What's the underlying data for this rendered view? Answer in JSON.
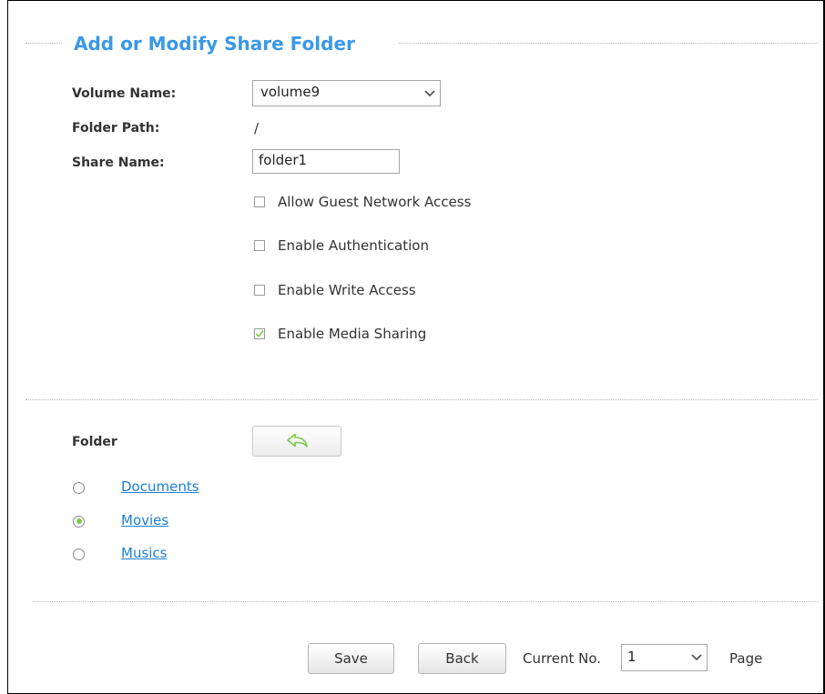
{
  "section_title": "Add or Modify Share Folder",
  "form": {
    "volume_label": "Volume Name:",
    "volume_value": "volume9",
    "path_label": "Folder Path:",
    "path_value": "/",
    "share_label": "Share Name:",
    "share_value": "folder1"
  },
  "options": [
    {
      "label": "Allow Guest Network Access",
      "checked": false
    },
    {
      "label": "Enable Authentication",
      "checked": false
    },
    {
      "label": "Enable Write Access",
      "checked": false
    },
    {
      "label": "Enable Media Sharing",
      "checked": true
    }
  ],
  "folder": {
    "label": "Folder",
    "back_icon": "reply-arrow-icon",
    "items": [
      {
        "name": "Documents",
        "selected": false
      },
      {
        "name": "Movies",
        "selected": true
      },
      {
        "name": "Musics",
        "selected": false
      }
    ]
  },
  "footer": {
    "save_label": "Save",
    "back_label": "Back",
    "current_no_label": "Current No.",
    "current_no_value": "1",
    "page_label": "Page"
  },
  "colors": {
    "title": "#3a98e8",
    "link": "#1c7fd6",
    "accent_green": "#7ec84a"
  }
}
